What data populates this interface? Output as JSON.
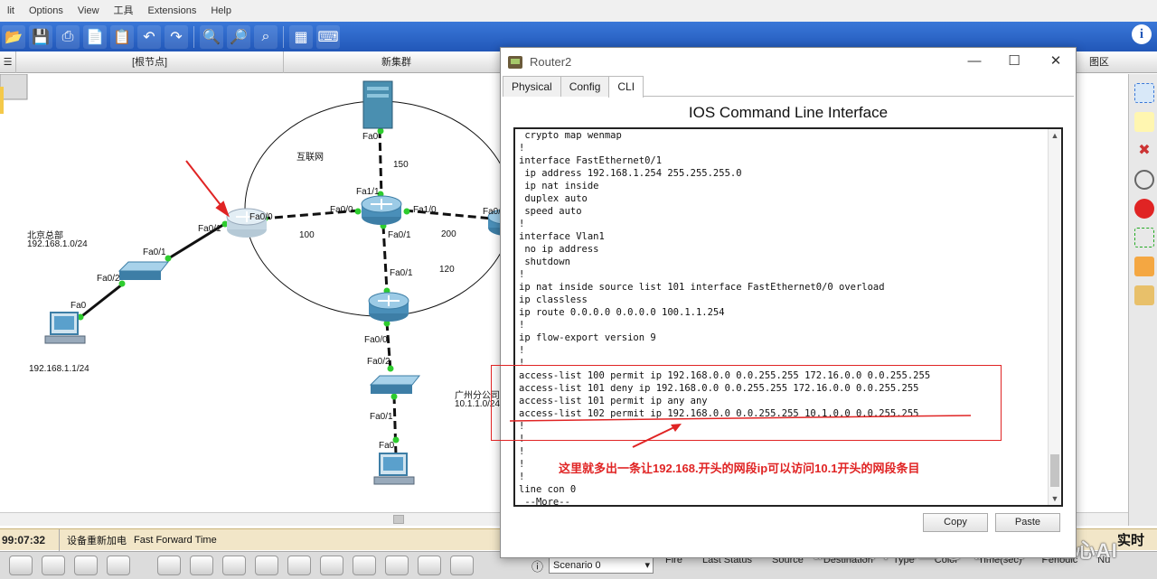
{
  "menu": [
    "lit",
    "Options",
    "View",
    "工具",
    "Extensions",
    "Help"
  ],
  "logical_bar": {
    "root": "[根节点]",
    "cluster": "新集群",
    "right_fragment": "图区"
  },
  "workspace": {
    "internet_label": "互联网",
    "beijing_name": "北京总部",
    "beijing_net": "192.168.1.0/24",
    "pc_ip": "192.168.1.1/24",
    "guangzhou_name": "广州分公司",
    "guangzhou_net": "10.1.1.0/24",
    "ports": {
      "server_fa0": "Fa0",
      "core_fa1_1": "Fa1/1",
      "core_fa0_0": "Fa0/0",
      "core_fa1_0": "Fa1/0",
      "core_fa0_1": "Fa0/1",
      "r2_fa0_0": "Fa0/0",
      "r2_fa0_1": "Fa0/1",
      "sw_fa0_1": "Fa0/1",
      "sw_fa0_2": "Fa0/2",
      "pc_fa0": "Fa0",
      "gz_fa0_1": "Fa0/1",
      "gz_fa0_0": "Fa0/0",
      "gzsw_fa0_2": "Fa0/2",
      "gzsw_fa0_1": "Fa0/1",
      "gzpc_fa0": "Fa0",
      "right_fa0": "Fa0/"
    },
    "link_numbers": {
      "l150": "150",
      "l100": "100",
      "l200": "200",
      "l120": "120"
    }
  },
  "status": {
    "time": "99:07:32",
    "event": "设备重新加电",
    "ff": "Fast Forward Time",
    "mode": "实时"
  },
  "bottom": {
    "scenario": "Scenario 0",
    "headers": [
      "Fire",
      "Last Status",
      "Source",
      "Destination",
      "Type",
      "Color",
      "Time(sec)",
      "Periodic",
      "Nu"
    ]
  },
  "watermark": "掘金技术社区 @ 机器学习之心AI",
  "dialog": {
    "title": "Router2",
    "tabs": [
      "Physical",
      "Config",
      "CLI"
    ],
    "heading": "IOS Command Line Interface",
    "cli_lines": [
      " crypto map wenmap",
      "!",
      "interface FastEthernet0/1",
      " ip address 192.168.1.254 255.255.255.0",
      " ip nat inside",
      " duplex auto",
      " speed auto",
      "!",
      "interface Vlan1",
      " no ip address",
      " shutdown",
      "!",
      "ip nat inside source list 101 interface FastEthernet0/0 overload",
      "ip classless",
      "ip route 0.0.0.0 0.0.0.0 100.1.1.254",
      "!",
      "ip flow-export version 9",
      "!",
      "!",
      "access-list 100 permit ip 192.168.0.0 0.0.255.255 172.16.0.0 0.0.255.255",
      "access-list 101 deny ip 192.168.0.0 0.0.255.255 172.16.0.0 0.0.255.255",
      "access-list 101 permit ip any any",
      "access-list 102 permit ip 192.168.0.0 0.0.255.255 10.1.0.0 0.0.255.255",
      "!",
      "!",
      "!",
      "!",
      "!",
      "line con 0",
      " --More--"
    ],
    "annotation": "这里就多出一条让192.168.开头的网段ip可以访问10.1开头的网段条目",
    "copy": "Copy",
    "paste": "Paste"
  },
  "colors": {
    "toolbar": "#2f6cd0",
    "status_bg": "#f2e6c8",
    "annotation": "#e02424",
    "link_up": "#2ecc2e"
  }
}
